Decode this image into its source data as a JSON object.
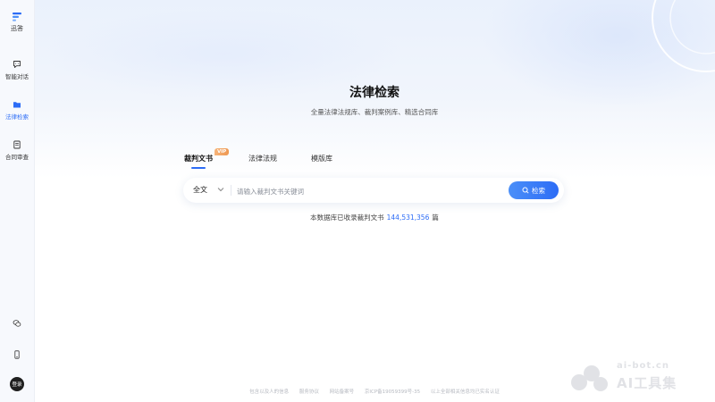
{
  "colors": {
    "accent": "#2c6cf6",
    "vip": "#ee9751",
    "sidebar_bg": "#f7f9fd"
  },
  "sidebar": {
    "logo_label": "迅答",
    "items": [
      {
        "label": "智能对话",
        "icon": "chat-icon",
        "active": false
      },
      {
        "label": "法律检索",
        "icon": "folder-icon",
        "active": true
      },
      {
        "label": "合同审查",
        "icon": "document-icon",
        "active": false
      }
    ],
    "bottom_icons": [
      "wechat-icon",
      "mobile-icon"
    ],
    "login_label": "登录"
  },
  "main": {
    "title": "法律检索",
    "subtitle": "全量法律法规库、裁判案例库、精选合同库",
    "tabs": [
      {
        "label": "裁判文书",
        "active": true,
        "badge": "VIP"
      },
      {
        "label": "法律法规",
        "active": false
      },
      {
        "label": "模版库",
        "active": false
      }
    ],
    "search": {
      "scope": "全文",
      "placeholder": "请输入裁判文书关键词",
      "value": "",
      "button_label": "检索"
    },
    "stats": {
      "prefix": "本数据库已收录裁判文书",
      "count": "144,531,356",
      "suffix": "篇"
    }
  },
  "footer": {
    "items": [
      "包含以及人的信息",
      "服务协议",
      "网站备案号",
      "京ICP备19059399号-35",
      "以上全部相关信息均已实名认证"
    ]
  },
  "watermark": {
    "url": "ai-bot.cn",
    "text": "AI工具集"
  }
}
